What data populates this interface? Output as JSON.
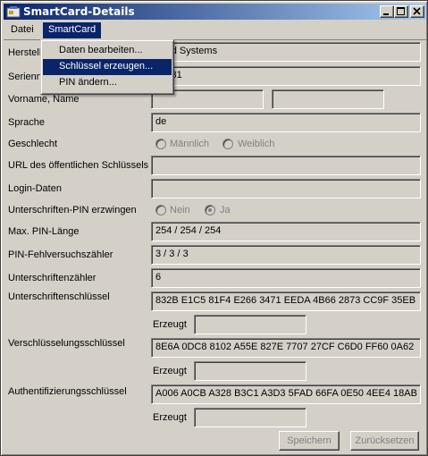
{
  "window": {
    "title": "SmartCard-Details"
  },
  "menubar": {
    "datei": "Datei",
    "smartcard": "SmartCard"
  },
  "dropdown": {
    "items": [
      {
        "label": "Daten bearbeiten..."
      },
      {
        "label": "Schlüssel erzeugen..."
      },
      {
        "label": "PIN ändern..."
      }
    ]
  },
  "form": {
    "hersteller": {
      "label": "Herstell",
      "value": "Card Systems"
    },
    "seriennummer": {
      "label": "Seriennu",
      "value": "01131"
    },
    "name": {
      "label": "Vorname, Name",
      "first": "",
      "last": ""
    },
    "sprache": {
      "label": "Sprache",
      "value": "de"
    },
    "geschlecht": {
      "label": "Geschlecht",
      "option1": "Männlich",
      "option2": "Weiblich"
    },
    "url": {
      "label": "URL des öffentlichen Schlüssels",
      "value": ""
    },
    "login": {
      "label": "Login-Daten",
      "value": ""
    },
    "pin_erzwingen": {
      "label": "Unterschriften-PIN erzwingen",
      "option_no": "Nein",
      "option_yes": "Ja"
    },
    "pin_laenge": {
      "label": "Max. PIN-Länge",
      "value": "254 / 254 / 254"
    },
    "fehlversuch": {
      "label": "PIN-Fehlversuchszähler",
      "value": "3 / 3 / 3"
    },
    "unterschriftenzaehler": {
      "label": "Unterschriftenzähler",
      "value": "6"
    },
    "sig_key": {
      "label": "Unterschriftenschlüssel",
      "value": "832B E1C5 81F4 E266 3471 EEDA 4B66 2873 CC9F 35EB",
      "created_label": "Erzeugt",
      "created": ""
    },
    "enc_key": {
      "label": "Verschlüsselungsschlüssel",
      "value": "8E6A 0DC8 8102 A55E 827E 7707 27CF C6D0 FF60 0A62",
      "created_label": "Erzeugt",
      "created": ""
    },
    "auth_key": {
      "label": "Authentifizierungsschlüssel",
      "value": "A006 A0CB A328 B3C1 A3D3 5FAD 66FA 0E50 4EE4 18AB",
      "created_label": "Erzeugt",
      "created": ""
    }
  },
  "buttons": {
    "save": "Speichern",
    "reset": "Zurücksetzen"
  }
}
